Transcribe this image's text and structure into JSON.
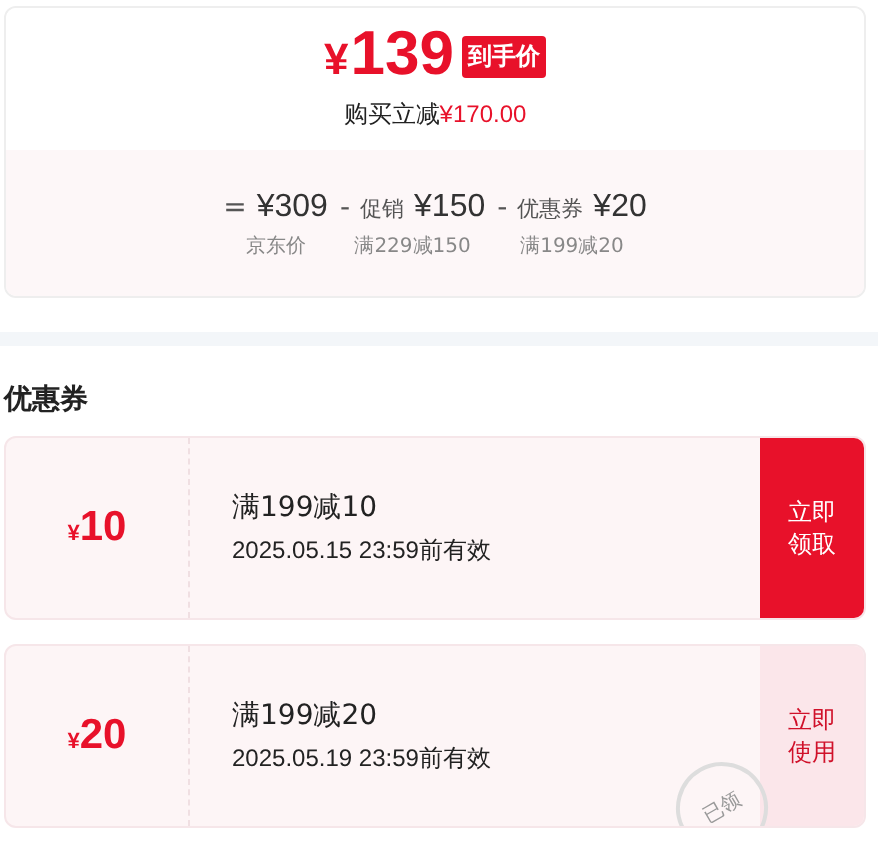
{
  "price": {
    "currency": "¥",
    "amount": "139",
    "badge": "到手价",
    "saving_label": "购买立减",
    "saving_amount": "¥170.00"
  },
  "breakdown": [
    {
      "operator": "=",
      "amount": "¥309",
      "caption": "京东价"
    },
    {
      "operator": "-",
      "label": "促销",
      "amount": "¥150",
      "caption": "满229减150"
    },
    {
      "operator": "-",
      "label": "优惠券",
      "amount": "¥20",
      "caption": "满199减20"
    }
  ],
  "coupons_title": "优惠券",
  "coupons": [
    {
      "currency": "¥",
      "value": "10",
      "condition": "满199减10",
      "validity": "2025.05.15 23:59前有效",
      "action": "立即领取",
      "claimed": false
    },
    {
      "currency": "¥",
      "value": "20",
      "condition": "满199减20",
      "validity": "2025.05.19 23:59前有效",
      "action": "立即使用",
      "claimed": true,
      "stamp": "已领"
    }
  ]
}
